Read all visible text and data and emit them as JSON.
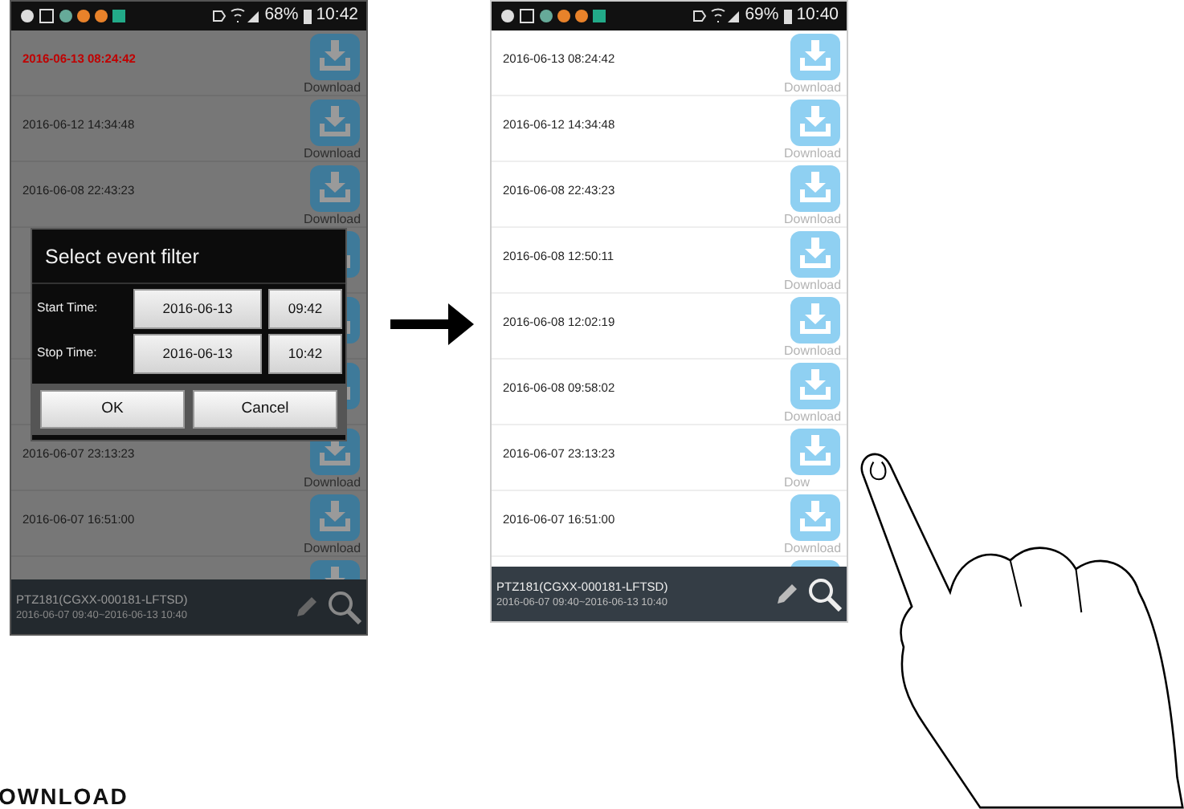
{
  "phones": [
    {
      "status_bar": {
        "battery": "68%",
        "time": "10:42"
      },
      "events": [
        {
          "kind": "event",
          "time": "2016-06-13 08:24:42",
          "selected": true,
          "download_label": "Download"
        },
        {
          "kind": "event",
          "time": "2016-06-12 14:34:48",
          "selected": false,
          "download_label": "Download"
        },
        {
          "kind": "event",
          "time": "2016-06-08 22:43:23",
          "selected": false,
          "download_label": "Download"
        },
        {
          "kind": "covered"
        },
        {
          "kind": "covered"
        },
        {
          "kind": "covered"
        },
        {
          "kind": "event",
          "time": "2016-06-07 23:13:23",
          "selected": false,
          "download_label": "Download"
        },
        {
          "kind": "event",
          "time": "2016-06-07 16:51:00",
          "selected": false,
          "download_label": "Download"
        },
        {
          "kind": "covered"
        }
      ],
      "dialog": {
        "title": "Select event filter",
        "rows": [
          {
            "label": "Start Time:",
            "date": "2016-06-13",
            "time": "09:42"
          },
          {
            "label": "Stop Time:",
            "date": "2016-06-13",
            "time": "10:42"
          }
        ],
        "buttons": [
          "OK",
          "Cancel"
        ]
      },
      "footer": {
        "camera": "PTZ181(CGXX-000181-LFTSD)",
        "range": "2016-06-07 09:40~2016-06-13 10:40"
      }
    },
    {
      "status_bar": {
        "battery": "69%",
        "time": "10:40"
      },
      "events": [
        {
          "kind": "event",
          "time": "2016-06-13 08:24:42",
          "selected": false,
          "download_label": "Download"
        },
        {
          "kind": "event",
          "time": "2016-06-12 14:34:48",
          "selected": false,
          "download_label": "Download"
        },
        {
          "kind": "event",
          "time": "2016-06-08 22:43:23",
          "selected": false,
          "download_label": "Download"
        },
        {
          "kind": "event",
          "time": "2016-06-08 12:50:11",
          "selected": false,
          "download_label": "Download"
        },
        {
          "kind": "event",
          "time": "2016-06-08 12:02:19",
          "selected": false,
          "download_label": "Download"
        },
        {
          "kind": "event",
          "time": "2016-06-08 09:58:02",
          "selected": false,
          "download_label": "Download"
        },
        {
          "kind": "event",
          "time": "2016-06-07 23:13:23",
          "selected": false,
          "download_label": "Dow"
        },
        {
          "kind": "event",
          "time": "2016-06-07 16:51:00",
          "selected": false,
          "download_label": "Download"
        },
        {
          "kind": "covered"
        }
      ],
      "footer": {
        "camera": "PTZ181(CGXX-000181-LFTSD)",
        "range": "2016-06-07 09:40~2016-06-13 10:40"
      }
    }
  ],
  "caption": "OWNLOAD"
}
